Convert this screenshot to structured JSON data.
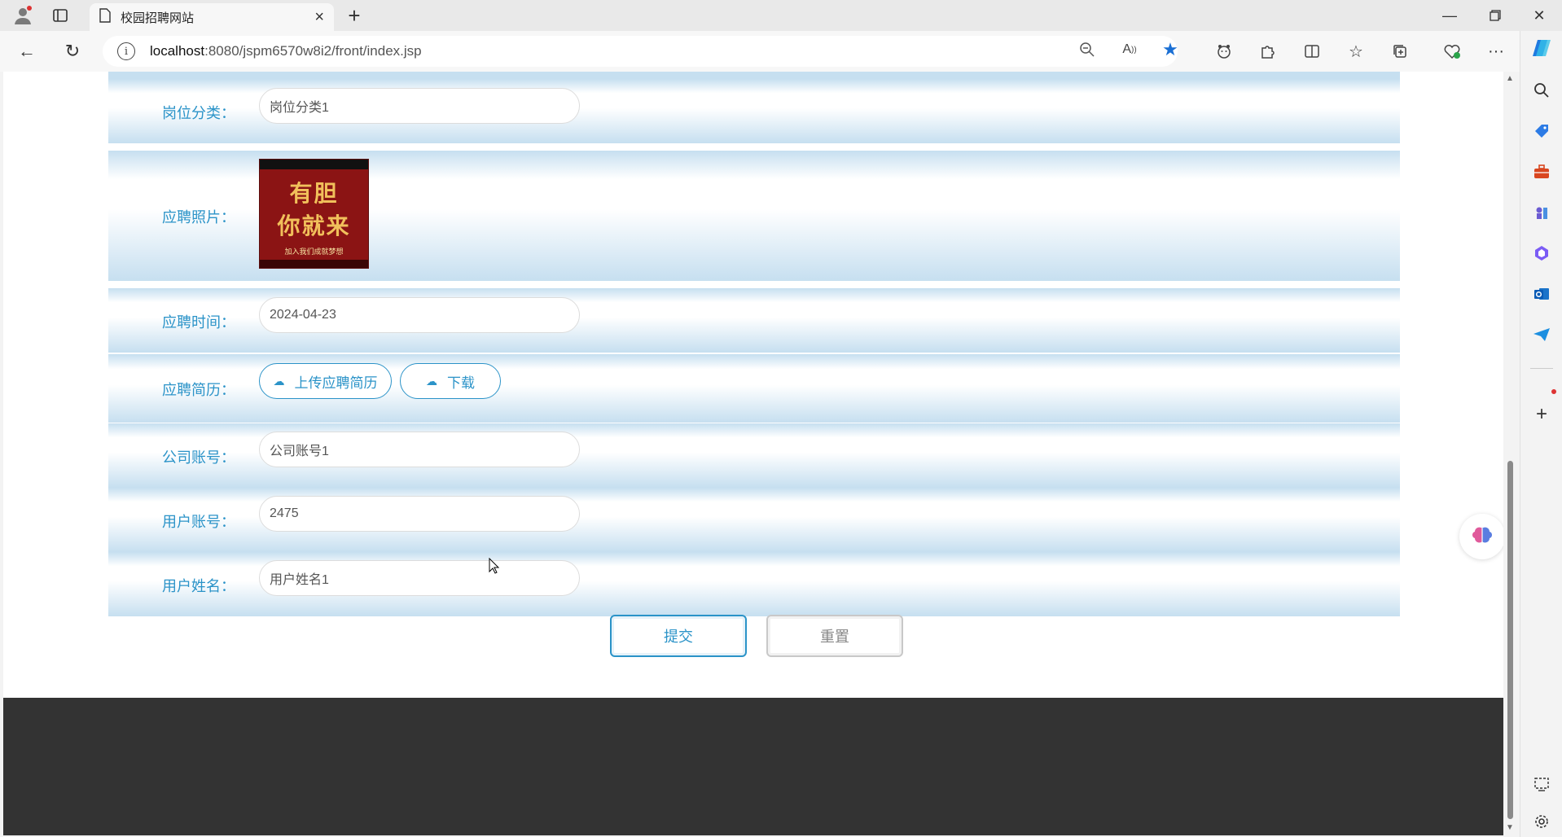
{
  "browser": {
    "tab_title": "校园招聘网站",
    "url_host": "localhost",
    "url_rest": ":8080/jspm6570w8i2/front/index.jsp"
  },
  "form": {
    "category_label": "岗位分类：",
    "category_value": "岗位分类1",
    "photo_label": "应聘照片：",
    "photo_text_line1": "有胆",
    "photo_text_line2": "你就来",
    "photo_text_line3": "加入我们成就梦想",
    "time_label": "应聘时间：",
    "time_value": "2024-04-23",
    "resume_label": "应聘简历：",
    "upload_button": "上传应聘简历",
    "download_button": "下载",
    "company_label": "公司账号：",
    "company_value": "公司账号1",
    "user_account_label": "用户账号：",
    "user_account_value": "2475",
    "user_name_label": "用户姓名：",
    "user_name_value": "用户姓名1",
    "submit_button": "提交",
    "reset_button": "重置"
  },
  "colors": {
    "accent": "#2b93c8",
    "row_gradient_edge": "#c6dff0",
    "footer": "#333333",
    "favorite_star": "#1a6fd4"
  },
  "icons": {
    "tab_page": "page-icon",
    "upload": "cloud-upload-icon",
    "download": "cloud-download-icon"
  }
}
